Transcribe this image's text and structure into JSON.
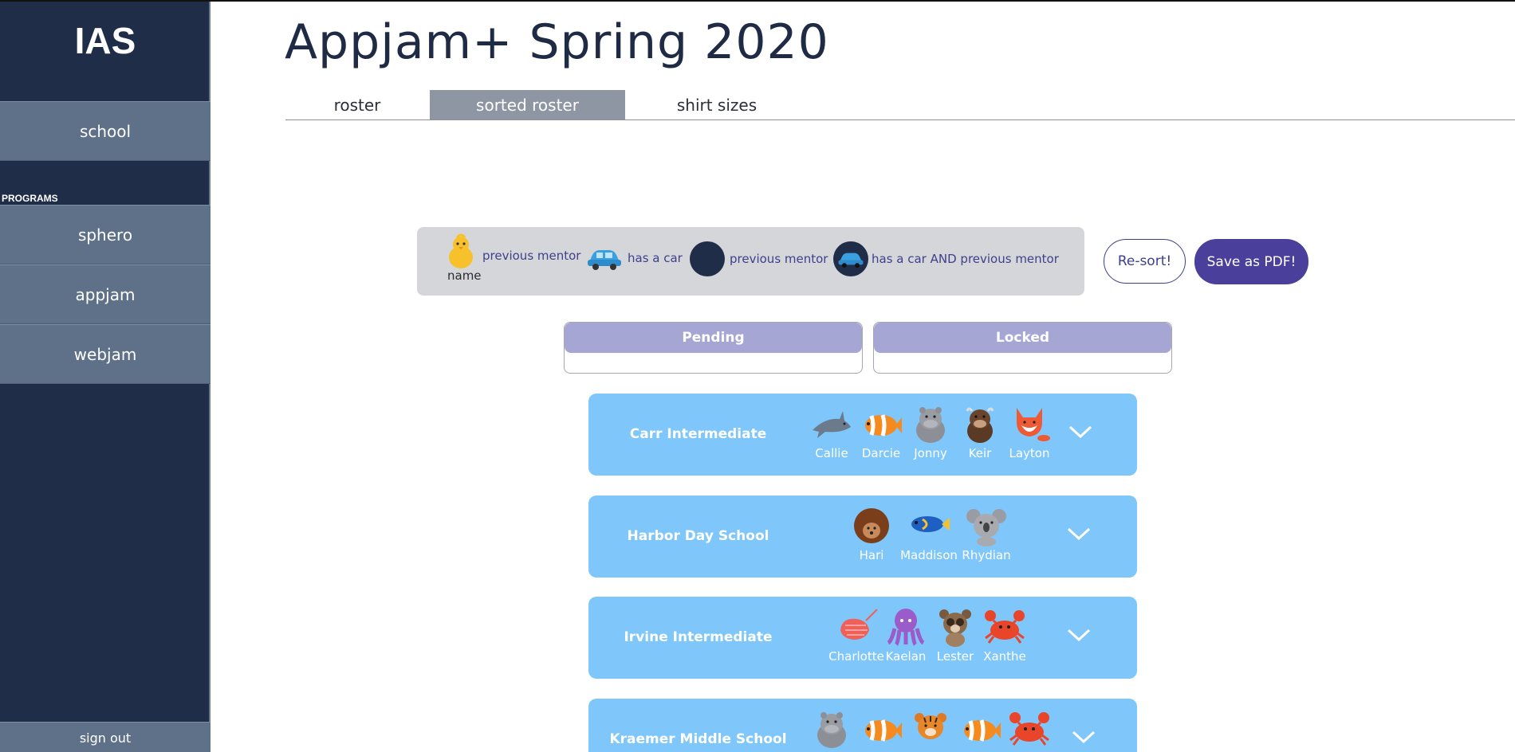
{
  "sidebar": {
    "logo": "IAS",
    "school_label": "school",
    "section_label": "PROGRAMS",
    "programs": [
      "sphero",
      "appjam",
      "webjam"
    ],
    "signout_label": "sign out"
  },
  "header": {
    "title": "Appjam+ Spring 2020",
    "tabs": [
      "roster",
      "sorted roster",
      "shirt sizes"
    ],
    "active_tab": "sorted roster"
  },
  "legend": {
    "name_caption": "name",
    "prev_mentor_1": "previous mentor",
    "has_car": "has a car",
    "prev_mentor_2": "previous mentor",
    "car_and_prev": "has a car AND previous mentor"
  },
  "actions": {
    "resort_label": "Re-sort!",
    "pdf_label": "Save as PDF!"
  },
  "status": {
    "pending_label": "Pending",
    "locked_label": "Locked"
  },
  "schools": [
    {
      "name": "Carr Intermediate",
      "students": [
        {
          "name": "Callie",
          "icon": "shark-icon"
        },
        {
          "name": "Darcie",
          "icon": "clownfish-icon"
        },
        {
          "name": "Jonny",
          "icon": "hippo-icon"
        },
        {
          "name": "Keir",
          "icon": "bull-icon"
        },
        {
          "name": "Layton",
          "icon": "fox-icon"
        }
      ]
    },
    {
      "name": "Harbor Day School",
      "students": [
        {
          "name": "Hari",
          "icon": "hedgehog-icon"
        },
        {
          "name": "Maddison",
          "icon": "tang-fish-icon"
        },
        {
          "name": "Rhydian",
          "icon": "koala-icon"
        }
      ]
    },
    {
      "name": "Irvine Intermediate",
      "students": [
        {
          "name": "Charlotte",
          "icon": "shrimp-icon"
        },
        {
          "name": "Kaelan",
          "icon": "octopus-icon"
        },
        {
          "name": "Lester",
          "icon": "lemur-icon"
        },
        {
          "name": "Xanthe",
          "icon": "crab-icon"
        }
      ]
    },
    {
      "name": "Kraemer Middle School",
      "students": [
        {
          "name": "",
          "icon": "hippo-icon"
        },
        {
          "name": "",
          "icon": "clownfish-icon"
        },
        {
          "name": "",
          "icon": "tiger-icon"
        },
        {
          "name": "",
          "icon": "clownfish-icon"
        },
        {
          "name": "",
          "icon": "crab-icon"
        }
      ]
    }
  ]
}
